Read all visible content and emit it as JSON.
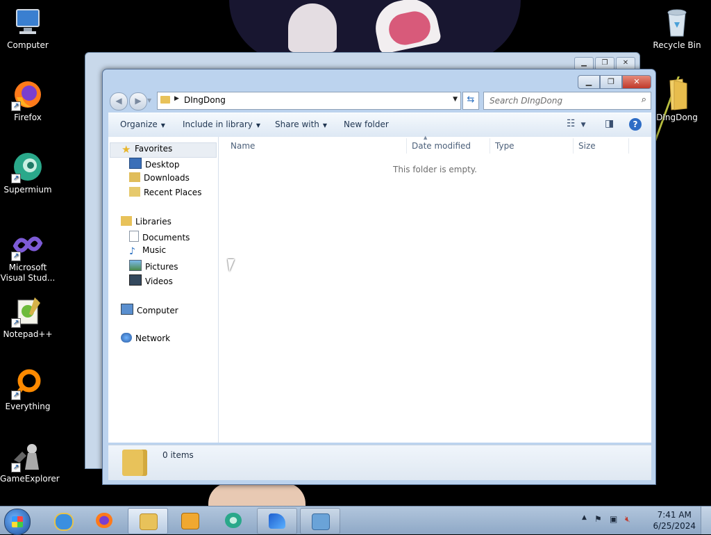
{
  "desktop": {
    "icons_left": [
      {
        "label": "Computer",
        "icon": "computer-icon"
      },
      {
        "label": "Firefox",
        "icon": "firefox-icon"
      },
      {
        "label": "Supermium",
        "icon": "supermium-icon"
      },
      {
        "label": "Microsoft Visual Stud...",
        "icon": "visual-studio-icon"
      },
      {
        "label": "Notepad++",
        "icon": "notepadpp-icon"
      },
      {
        "label": "Everything",
        "icon": "everything-icon"
      },
      {
        "label": "GameExplorer",
        "icon": "gameexplorer-icon"
      }
    ],
    "icons_right": [
      {
        "label": "Recycle Bin",
        "icon": "recycle-bin-icon"
      },
      {
        "label": "DIngDong",
        "icon": "folder-icon"
      }
    ]
  },
  "explorer": {
    "address_path": "DIngDong",
    "search_placeholder": "Search DIngDong",
    "toolbar": {
      "organize": "Organize",
      "include_in_library": "Include in library",
      "share_with": "Share with",
      "new_folder": "New folder"
    },
    "nav": {
      "favorites": "Favorites",
      "desktop": "Desktop",
      "downloads": "Downloads",
      "recent_places": "Recent Places",
      "libraries": "Libraries",
      "documents": "Documents",
      "music": "Music",
      "pictures": "Pictures",
      "videos": "Videos",
      "computer": "Computer",
      "network": "Network"
    },
    "columns": {
      "name": "Name",
      "date_modified": "Date modified",
      "type": "Type",
      "size": "Size"
    },
    "empty_message": "This folder is empty.",
    "item_count": "0 items"
  },
  "taskbar": {
    "apps": [
      "internet-explorer-icon",
      "firefox-icon",
      "file-explorer-icon",
      "media-player-icon",
      "supermium-icon",
      "app-icon",
      "control-panel-icon"
    ],
    "clock_time": "7:41 AM",
    "clock_date": "6/25/2024"
  },
  "colors": {
    "accent": "#2d6cc5",
    "window_frame": "#bcd3ee",
    "close_button": "#c0392b",
    "folder": "#e8c25a"
  }
}
